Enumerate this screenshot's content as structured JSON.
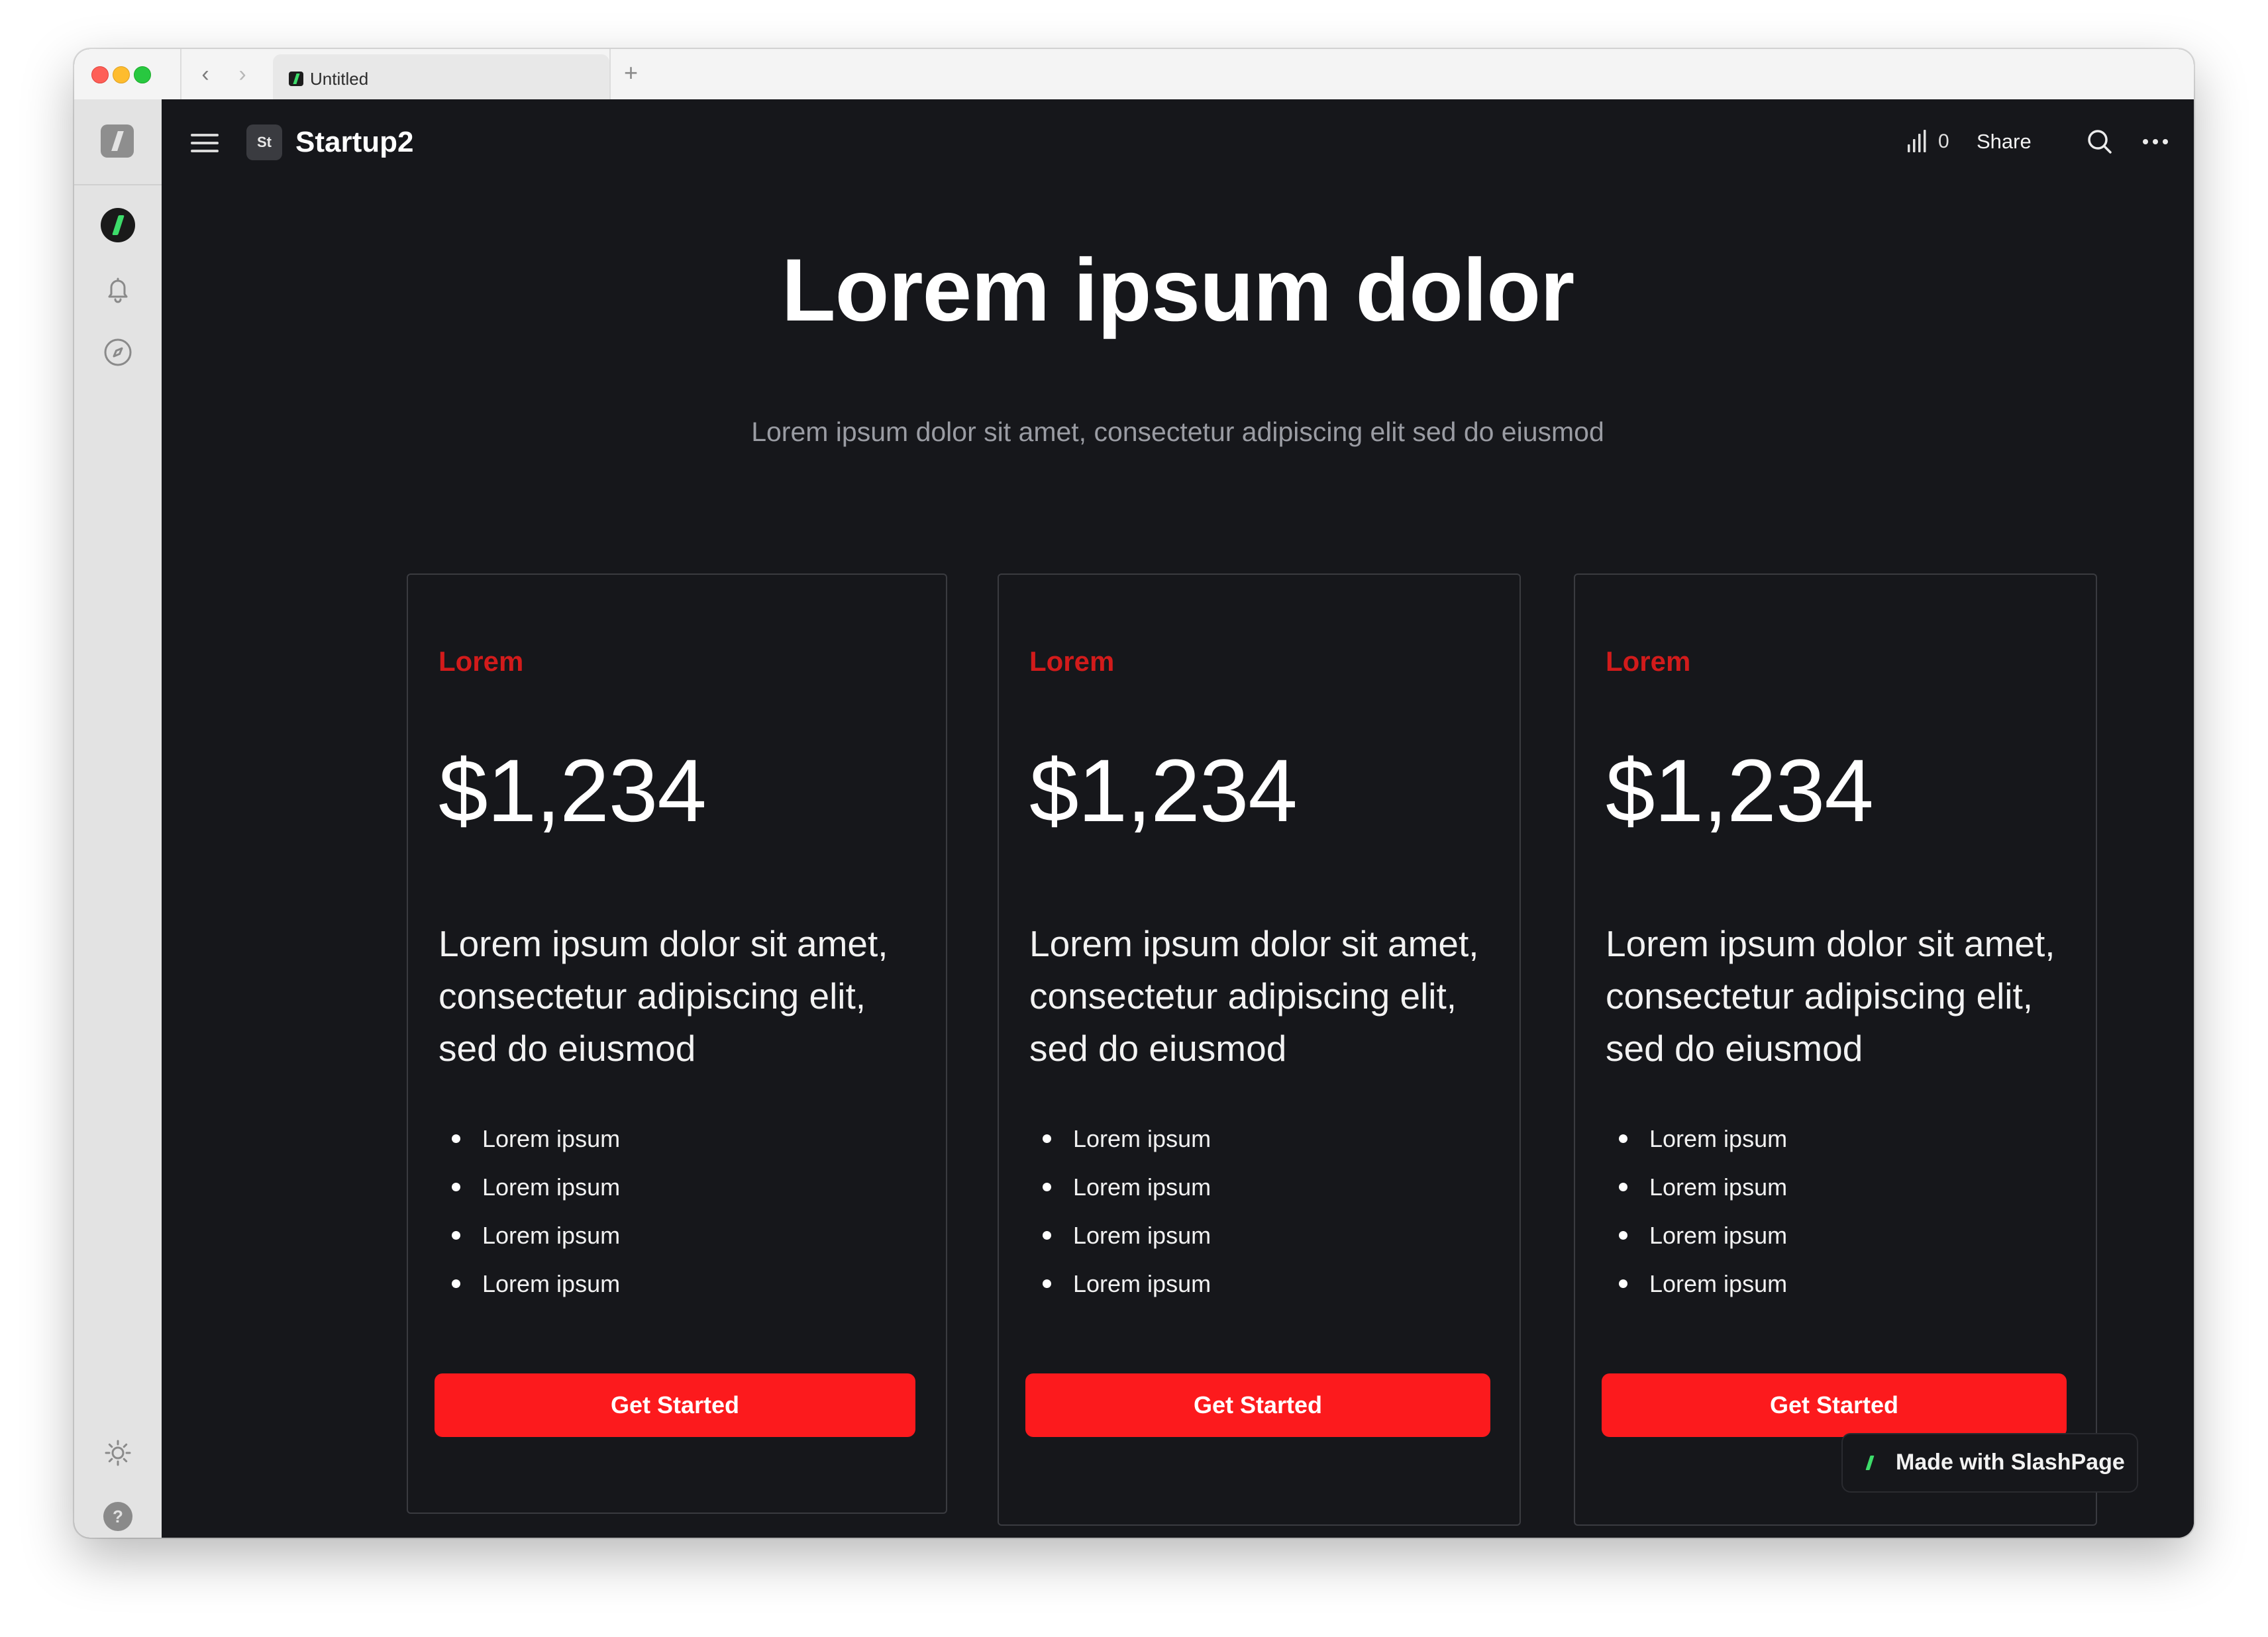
{
  "browser": {
    "tab_title": "Untitled",
    "new_tab_label": "+"
  },
  "header": {
    "workspace_badge": "St",
    "workspace_name": "Startup2",
    "views_count": "0",
    "share_label": "Share"
  },
  "hero": {
    "title": "Lorem ipsum dolor",
    "subtitle": "Lorem ipsum dolor sit amet, consectetur adipiscing elit sed do eiusmod"
  },
  "pricing": [
    {
      "label": "Lorem",
      "price": "$1,234",
      "description": "Lorem ipsum dolor sit amet, consectetur adipiscing elit, sed do eiusmod",
      "features": [
        "Lorem ipsum",
        "Lorem ipsum",
        "Lorem ipsum",
        "Lorem ipsum"
      ],
      "cta": "Get Started"
    },
    {
      "label": "Lorem",
      "price": "$1,234",
      "description": "Lorem ipsum dolor sit amet, consectetur adipiscing elit, sed do eiusmod",
      "features": [
        "Lorem ipsum",
        "Lorem ipsum",
        "Lorem ipsum",
        "Lorem ipsum"
      ],
      "cta": "Get Started"
    },
    {
      "label": "Lorem",
      "price": "$1,234",
      "description": "Lorem ipsum dolor sit amet, consectetur adipiscing elit, sed do eiusmod",
      "features": [
        "Lorem ipsum",
        "Lorem ipsum",
        "Lorem ipsum",
        "Lorem ipsum"
      ],
      "cta": "Get Started"
    }
  ],
  "footer_badge": {
    "label": "Made with SlashPage"
  },
  "icons": {
    "sidebar": [
      "slashpage-logo-icon",
      "home-icon",
      "bell-icon",
      "compass-icon",
      "sun-icon",
      "help-icon"
    ],
    "header": [
      "menu-icon",
      "bar-chart-icon",
      "search-icon",
      "more-icon"
    ]
  },
  "colors": {
    "background": "#16171b",
    "accent_red": "#fc1a1d",
    "label_red": "#d21b1b",
    "brand_green": "#3ddc6a",
    "sidebar": "#e3e3e3"
  }
}
